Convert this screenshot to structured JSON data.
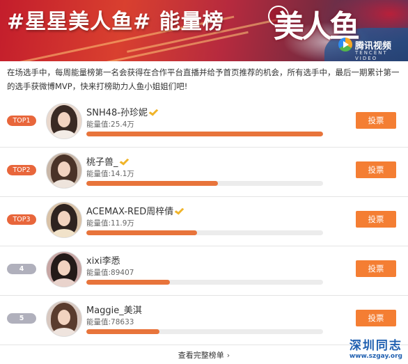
{
  "banner": {
    "title": "#星星美人鱼#  能量榜",
    "show_logo": "美人鱼",
    "seal_text": "星",
    "platform_name": "腾讯视频",
    "platform_sub": "TENCENT VIDEO"
  },
  "intro": "在场选手中，每周能量榜第一名会获得在合作平台直播并给予首页推荐的机会，所有选手中，最后一期累计第一的选手获微博MVP，快来打榜助力人鱼小姐姐们吧!",
  "colors": {
    "accent": "#f47e33",
    "rank_top": "#e8663b",
    "rank_other": "#b0b0bc",
    "bar_fill": "#e8743b",
    "bar_track": "#ececec",
    "verified": "#f0b429"
  },
  "vote_label": "投票",
  "more_label": "查看完整榜单",
  "contestants": [
    {
      "rank": "TOP1",
      "name": "SNH48-孙珍妮",
      "energy": "能量值:25.4万",
      "progress": 1.0,
      "avatar_color": "#e9d8cd"
    },
    {
      "rank": "TOP2",
      "name": "桃子兽_",
      "energy": "能量值:14.1万",
      "progress": 0.555,
      "avatar_color": "#c9b7a8"
    },
    {
      "rank": "TOP3",
      "name": "ACEMAX-RED周梓倩",
      "energy": "能量值:11.9万",
      "progress": 0.468,
      "avatar_color": "#d9c2a7"
    },
    {
      "rank": "4",
      "name": "xixi李悉",
      "energy": "能量值:89407",
      "progress": 0.352,
      "avatar_color": "#c7a6a4"
    },
    {
      "rank": "5",
      "name": "Maggie_美淇",
      "energy": "能量值:78633",
      "progress": 0.31,
      "avatar_color": "#d8c8c0"
    }
  ],
  "watermark": {
    "title": "深圳同志",
    "url": "www.szgay.org"
  }
}
